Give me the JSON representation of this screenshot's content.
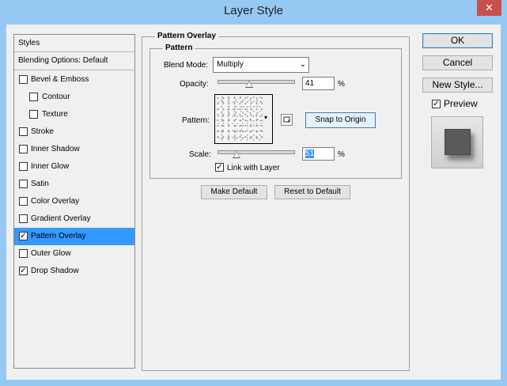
{
  "window": {
    "title": "Layer Style",
    "close_label": "✕"
  },
  "styles_list": {
    "header": "Styles",
    "blending_options": "Blending Options: Default",
    "items": [
      {
        "label": "Bevel & Emboss",
        "checked": false
      },
      {
        "label": "Contour",
        "checked": false
      },
      {
        "label": "Texture",
        "checked": false
      },
      {
        "label": "Stroke",
        "checked": false
      },
      {
        "label": "Inner Shadow",
        "checked": false
      },
      {
        "label": "Inner Glow",
        "checked": false
      },
      {
        "label": "Satin",
        "checked": false
      },
      {
        "label": "Color Overlay",
        "checked": false
      },
      {
        "label": "Gradient Overlay",
        "checked": false
      },
      {
        "label": "Pattern Overlay",
        "checked": true
      },
      {
        "label": "Outer Glow",
        "checked": false
      },
      {
        "label": "Drop Shadow",
        "checked": true
      }
    ],
    "selected_item": "Pattern Overlay"
  },
  "pattern_overlay": {
    "group_title": "Pattern Overlay",
    "subgroup_title": "Pattern",
    "blend_mode_label": "Blend Mode:",
    "blend_mode_value": "Multiply",
    "opacity_label": "Opacity:",
    "opacity_value": "41",
    "opacity_unit": "%",
    "pattern_label": "Pattern:",
    "snap_button": "Snap to Origin",
    "scale_label": "Scale:",
    "scale_value": "51",
    "scale_unit": "%",
    "link_with_layer_label": "Link with Layer",
    "link_with_layer_checked": true,
    "make_default_button": "Make Default",
    "reset_default_button": "Reset to Default"
  },
  "actions": {
    "ok": "OK",
    "cancel": "Cancel",
    "new_style": "New Style...",
    "preview_label": "Preview",
    "preview_checked": true
  },
  "check_glyph": "✓",
  "dropdown_glyph": "⌄",
  "colors": {
    "title_bar": "#95c8f3",
    "selection": "#3399ff",
    "close_button": "#c7504b",
    "dialog_bg": "#f0f0f0"
  }
}
